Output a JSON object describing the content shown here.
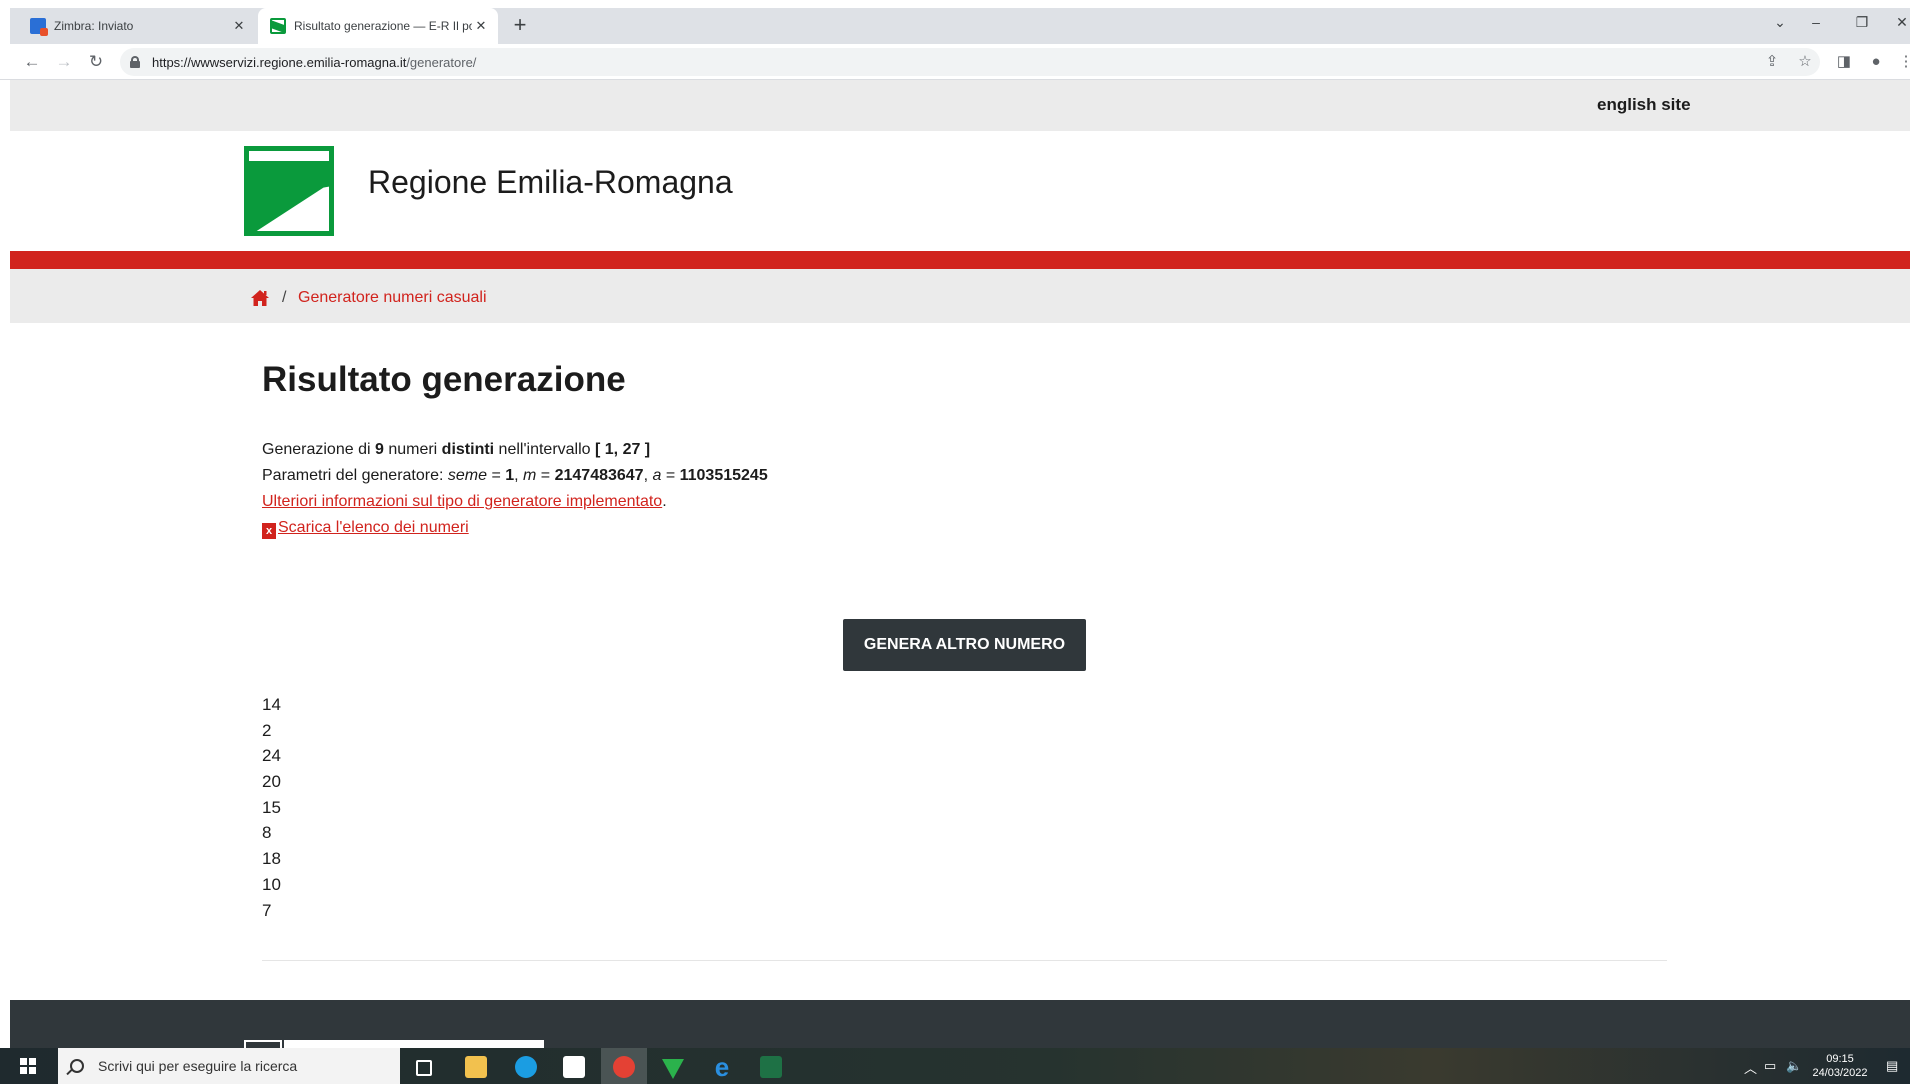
{
  "browser": {
    "tabs": [
      {
        "title": "Zimbra: Inviato",
        "active": false
      },
      {
        "title": "Risultato generazione — E-R Il po",
        "active": true
      }
    ],
    "url_host": "https://wwwservizi.regione.emilia-romagna.it",
    "url_path": "/generatore/"
  },
  "site": {
    "english_link": "english site",
    "name": "Regione Emilia-Romagna",
    "brand_green": "#0a9a3c",
    "accent_red": "#d1231d"
  },
  "breadcrumb": {
    "separator": "/",
    "current": "Generatore numeri casuali"
  },
  "result": {
    "title": "Risultato generazione",
    "line1": {
      "pre": "Generazione di ",
      "count": "9",
      "mid": " numeri ",
      "kind": "distinti",
      "post": " nell'intervallo ",
      "range": "[ 1, 27 ]"
    },
    "line2": {
      "pre": "Parametri del generatore: ",
      "seed_label": "seme",
      "eq1": " = ",
      "seed": "1",
      "sep1": ", ",
      "m_label": "m",
      "eq2": " = ",
      "m": "2147483647",
      "sep2": ", ",
      "a_label": "a",
      "eq3": " = ",
      "a": "1103515245"
    },
    "info_link": "Ulteriori informazioni sul tipo di generatore implementato",
    "info_link_suffix": ".",
    "download_link": "Scarica l'elenco dei numeri",
    "button": "GENERA ALTRO NUMERO",
    "numbers": [
      "14",
      "2",
      "24",
      "20",
      "15",
      "8",
      "18",
      "10",
      "7"
    ]
  },
  "taskbar": {
    "search_placeholder": "Scrivi qui per eseguire la ricerca",
    "time": "09:15",
    "date": "24/03/2022"
  }
}
